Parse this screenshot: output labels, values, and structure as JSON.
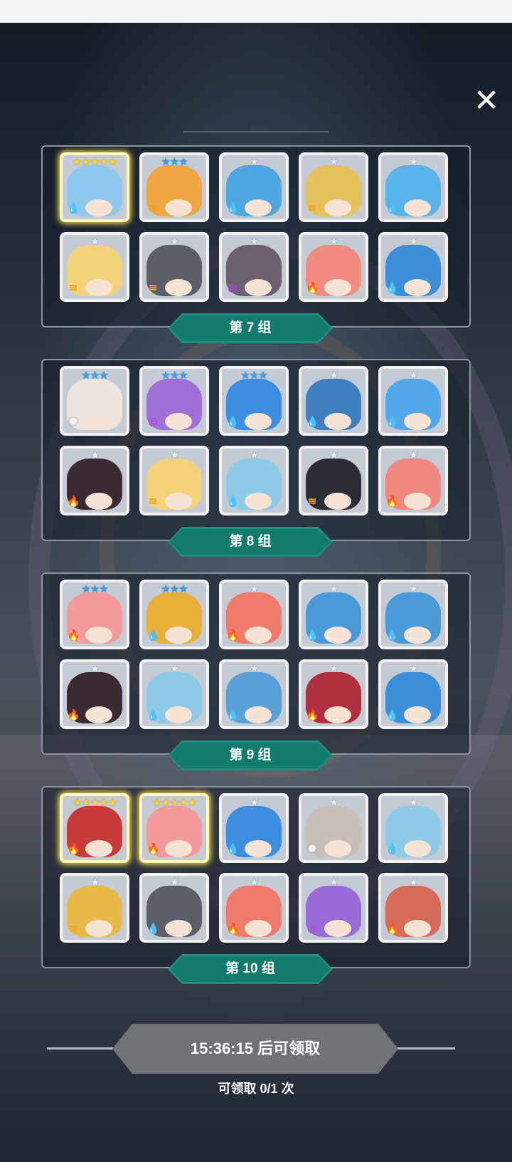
{
  "close_icon": "close-icon",
  "colors": {
    "panel_border": "#8c94a0",
    "label_teal": "#1f8d80",
    "card_bg": "#c4cbd4",
    "star_blue": "#3ea2e8",
    "star_gold": "#ffd52e",
    "button_gray": "#6e7377"
  },
  "groups": [
    {
      "label": "第 7 组",
      "cards": [
        {
          "stars": "★★★★★",
          "star_level": 5,
          "element": "water",
          "color": "#8ec8ee",
          "highlight": true
        },
        {
          "stars": "★★★",
          "star_level": 3,
          "element": "wind",
          "color": "#f0a640"
        },
        {
          "stars": "★",
          "star_level": 1,
          "element": "water",
          "color": "#4ea7e0"
        },
        {
          "stars": "★",
          "star_level": 1,
          "element": "wind",
          "color": "#e6c25a"
        },
        {
          "stars": "★",
          "star_level": 1,
          "element": "water",
          "color": "#5ab4ea"
        },
        {
          "stars": "★",
          "star_level": 1,
          "element": "wind",
          "color": "#f2d37a"
        },
        {
          "stars": "★",
          "star_level": 1,
          "element": "wind",
          "color": "#5a5f6a"
        },
        {
          "stars": "★",
          "star_level": 1,
          "element": "arcane",
          "color": "#6a6070"
        },
        {
          "stars": "★",
          "star_level": 1,
          "element": "fire",
          "color": "#f28c80"
        },
        {
          "stars": "★",
          "star_level": 1,
          "element": "water",
          "color": "#3a8fd8"
        }
      ]
    },
    {
      "label": "第 8 组",
      "cards": [
        {
          "stars": "★★★",
          "star_level": 3,
          "element": "light",
          "color": "#ece6de"
        },
        {
          "stars": "★★★",
          "star_level": 3,
          "element": "arcane",
          "color": "#a070d8"
        },
        {
          "stars": "★★★",
          "star_level": 3,
          "element": "water",
          "color": "#3c8ee0"
        },
        {
          "stars": "★",
          "star_level": 1,
          "element": "water",
          "color": "#3e7fc0"
        },
        {
          "stars": "★",
          "star_level": 1,
          "element": "water",
          "color": "#52a8e8"
        },
        {
          "stars": "★",
          "star_level": 1,
          "element": "fire",
          "color": "#3a2a34"
        },
        {
          "stars": "★",
          "star_level": 1,
          "element": "wind",
          "color": "#f4d27a"
        },
        {
          "stars": "★",
          "star_level": 1,
          "element": "water",
          "color": "#8ecbe8"
        },
        {
          "stars": "★",
          "star_level": 1,
          "element": "wind",
          "color": "#2c2c34"
        },
        {
          "stars": "★",
          "star_level": 1,
          "element": "fire",
          "color": "#f08880"
        }
      ]
    },
    {
      "label": "第 9 组",
      "cards": [
        {
          "stars": "★★★",
          "star_level": 3,
          "element": "fire",
          "color": "#f49a9c"
        },
        {
          "stars": "★★★",
          "star_level": 3,
          "element": "water",
          "color": "#e8b038"
        },
        {
          "stars": "★",
          "star_level": 1,
          "element": "fire",
          "color": "#f07a6c"
        },
        {
          "stars": "★",
          "star_level": 1,
          "element": "water",
          "color": "#4a9ad8"
        },
        {
          "stars": "★",
          "star_level": 1,
          "element": "water",
          "color": "#4a9ad8"
        },
        {
          "stars": "★",
          "star_level": 1,
          "element": "fire",
          "color": "#3a2a34"
        },
        {
          "stars": "★",
          "star_level": 1,
          "element": "water",
          "color": "#8ecbe8"
        },
        {
          "stars": "★",
          "star_level": 1,
          "element": "water",
          "color": "#5aa0d8"
        },
        {
          "stars": "★",
          "star_level": 1,
          "element": "fire",
          "color": "#b03040"
        },
        {
          "stars": "★",
          "star_level": 1,
          "element": "water",
          "color": "#3a8fd8"
        }
      ]
    },
    {
      "label": "第 10 组",
      "cards": [
        {
          "stars": "★★★★★",
          "star_level": 5,
          "element": "fire",
          "color": "#c83a3a",
          "highlight": true
        },
        {
          "stars": "★★★★★",
          "star_level": 5,
          "element": "fire",
          "color": "#f49a9c",
          "highlight": true
        },
        {
          "stars": "★",
          "star_level": 1,
          "element": "water",
          "color": "#3c8ee0"
        },
        {
          "stars": "★",
          "star_level": 1,
          "element": "light",
          "color": "#c8c0b8"
        },
        {
          "stars": "★",
          "star_level": 1,
          "element": "water",
          "color": "#8ecbe8"
        },
        {
          "stars": "★",
          "star_level": 1,
          "element": "wind",
          "color": "#e8b848"
        },
        {
          "stars": "★",
          "star_level": 1,
          "element": "water",
          "color": "#5a5f6a"
        },
        {
          "stars": "★",
          "star_level": 1,
          "element": "fire",
          "color": "#f07a6c"
        },
        {
          "stars": "★",
          "star_level": 1,
          "element": "arcane",
          "color": "#9a6ad8"
        },
        {
          "stars": "★",
          "star_level": 1,
          "element": "fire",
          "color": "#d86a5a"
        }
      ]
    }
  ],
  "claim": {
    "button_label": "15:36:15 后可领取",
    "count_text": "可领取 0/1 次"
  }
}
